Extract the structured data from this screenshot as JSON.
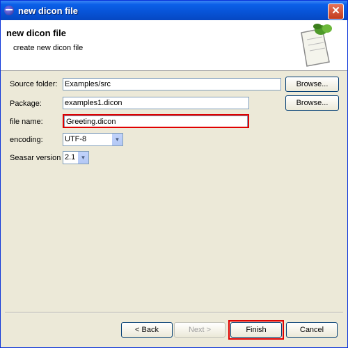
{
  "window": {
    "title": "new dicon file",
    "close_symbol": "✕"
  },
  "banner": {
    "title": "new dicon file",
    "description": "create new dicon file",
    "image_icon": "document-with-leaf-icon"
  },
  "form": {
    "source_folder": {
      "label": "Source folder:",
      "value": "Examples/src"
    },
    "package": {
      "label": "Package:",
      "value": "examples1.dicon"
    },
    "file_name": {
      "label": "file name:",
      "value": "Greeting.dicon"
    },
    "encoding": {
      "label": "encoding:",
      "value": "UTF-8"
    },
    "seasar_version": {
      "label": "Seasar version",
      "value": "2.1"
    }
  },
  "buttons": {
    "browse": "Browse...",
    "back": "< Back",
    "next": "Next >",
    "finish": "Finish",
    "cancel": "Cancel"
  },
  "colors": {
    "title_bar": "#0753d6",
    "highlight": "#e00000",
    "dialog_bg": "#ece9d8"
  }
}
